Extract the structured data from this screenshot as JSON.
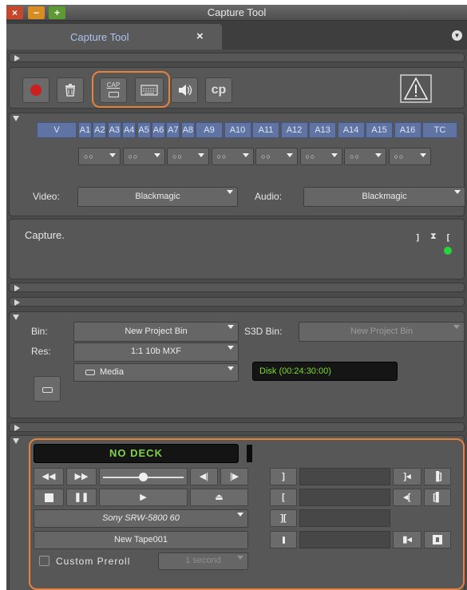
{
  "window": {
    "title": "Capture Tool",
    "controls": [
      "×",
      "−",
      "+"
    ]
  },
  "tab": {
    "label": "Capture Tool",
    "close": "×"
  },
  "toolbar": {
    "cap_label": "CAP",
    "cp_label": "cp"
  },
  "channels": {
    "items": [
      "V",
      "A1",
      "A2",
      "A3",
      "A4",
      "A5",
      "A6",
      "A7",
      "A8",
      "A9",
      "A10",
      "A11",
      "A12",
      "A13",
      "A14",
      "A15",
      "A16",
      "TC"
    ],
    "pair_label": "○○"
  },
  "inputs": {
    "video_label": "Video:",
    "video_value": "Blackmagic",
    "audio_label": "Audio:",
    "audio_value": "Blackmagic"
  },
  "status": {
    "message": "Capture."
  },
  "target": {
    "bin_label": "Bin:",
    "bin_value": "New Project Bin",
    "s3d_label": "S3D Bin:",
    "s3d_value": "New Project Bin",
    "res_label": "Res:",
    "res_value": "1:1 10b MXF",
    "media_value": "Media",
    "disk_value": "Disk (00:24:30:00)"
  },
  "deck": {
    "status": "NO DECK",
    "deck_select": "Sony SRW-5800 60",
    "tape": "New Tape001",
    "preroll_label": "Custom Preroll",
    "preroll_value": "1 second"
  },
  "colors": {
    "accent_orange": "#e8823a",
    "channel_blue": "#5f74a2",
    "deck_green": "#7fd24a",
    "disk_green": "#7ddc2c",
    "indicator_green": "#27d43a",
    "record_red": "#cc1f1f"
  }
}
